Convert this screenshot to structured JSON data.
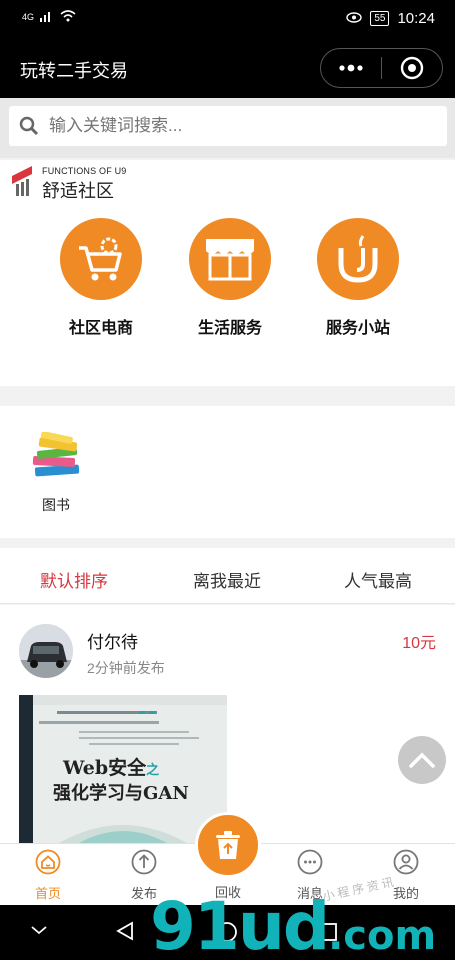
{
  "status": {
    "network": "4G",
    "battery": "55",
    "time": "10:24"
  },
  "header": {
    "title": "玩转二手交易"
  },
  "search": {
    "placeholder": "输入关键词搜索..."
  },
  "community": {
    "logo_small": "FUNCTIONS OF U9",
    "logo_big": "舒适社区",
    "categories": [
      {
        "label": "社区电商",
        "icon": "shopping-cart-icon"
      },
      {
        "label": "生活服务",
        "icon": "storefront-icon"
      },
      {
        "label": "服务小站",
        "icon": "station-icon"
      }
    ]
  },
  "book_category": {
    "label": "图书",
    "icon": "books-icon"
  },
  "sort_tabs": [
    "默认排序",
    "离我最近",
    "人气最高"
  ],
  "listing": {
    "user": "付尔待",
    "time": "2分钟前发布",
    "price": "10元",
    "photo_title_line1": "Web安全",
    "photo_title_suffix": "之",
    "photo_title_line2": "强化学习与GAN"
  },
  "tabbar": {
    "items": [
      {
        "label": "首页",
        "icon": "home-icon"
      },
      {
        "label": "发布",
        "icon": "upload-icon"
      },
      {
        "label": "回收",
        "icon": "recycle-icon"
      },
      {
        "label": "消息",
        "icon": "message-icon"
      },
      {
        "label": "我的",
        "icon": "profile-icon"
      }
    ]
  },
  "watermark": {
    "main": "91ud",
    "suffix": ".com",
    "sub": "小程序资讯"
  },
  "colors": {
    "accent": "#f08a24",
    "price": "#d9363e",
    "bar": "#000000"
  }
}
